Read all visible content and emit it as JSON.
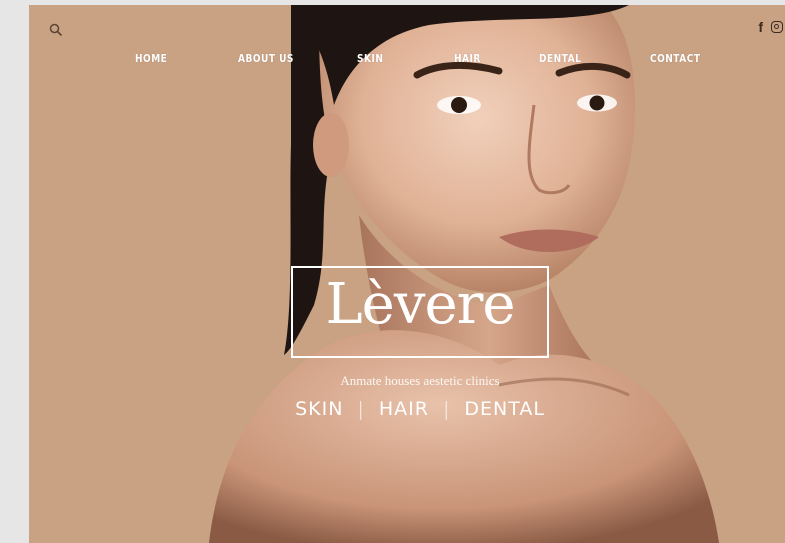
{
  "nav": {
    "items": [
      {
        "label": "HOME"
      },
      {
        "label": "ABOUT US"
      },
      {
        "label": "SKIN"
      },
      {
        "label": "HAIR"
      },
      {
        "label": "DENTAL"
      },
      {
        "label": "CONTACT"
      }
    ]
  },
  "header": {
    "search_icon": "search-icon",
    "social": [
      {
        "label": "f",
        "icon": "facebook-icon"
      },
      {
        "icon": "instagram-icon"
      }
    ]
  },
  "hero": {
    "logo": "Lèvere",
    "tagline": "Anmate houses aestetic clinics",
    "services": [
      "SKIN",
      "HAIR",
      "DENTAL"
    ],
    "separator": "|"
  },
  "colors": {
    "background": "#c9a183",
    "text": "#ffffff",
    "outer": "#e6e6e6"
  }
}
